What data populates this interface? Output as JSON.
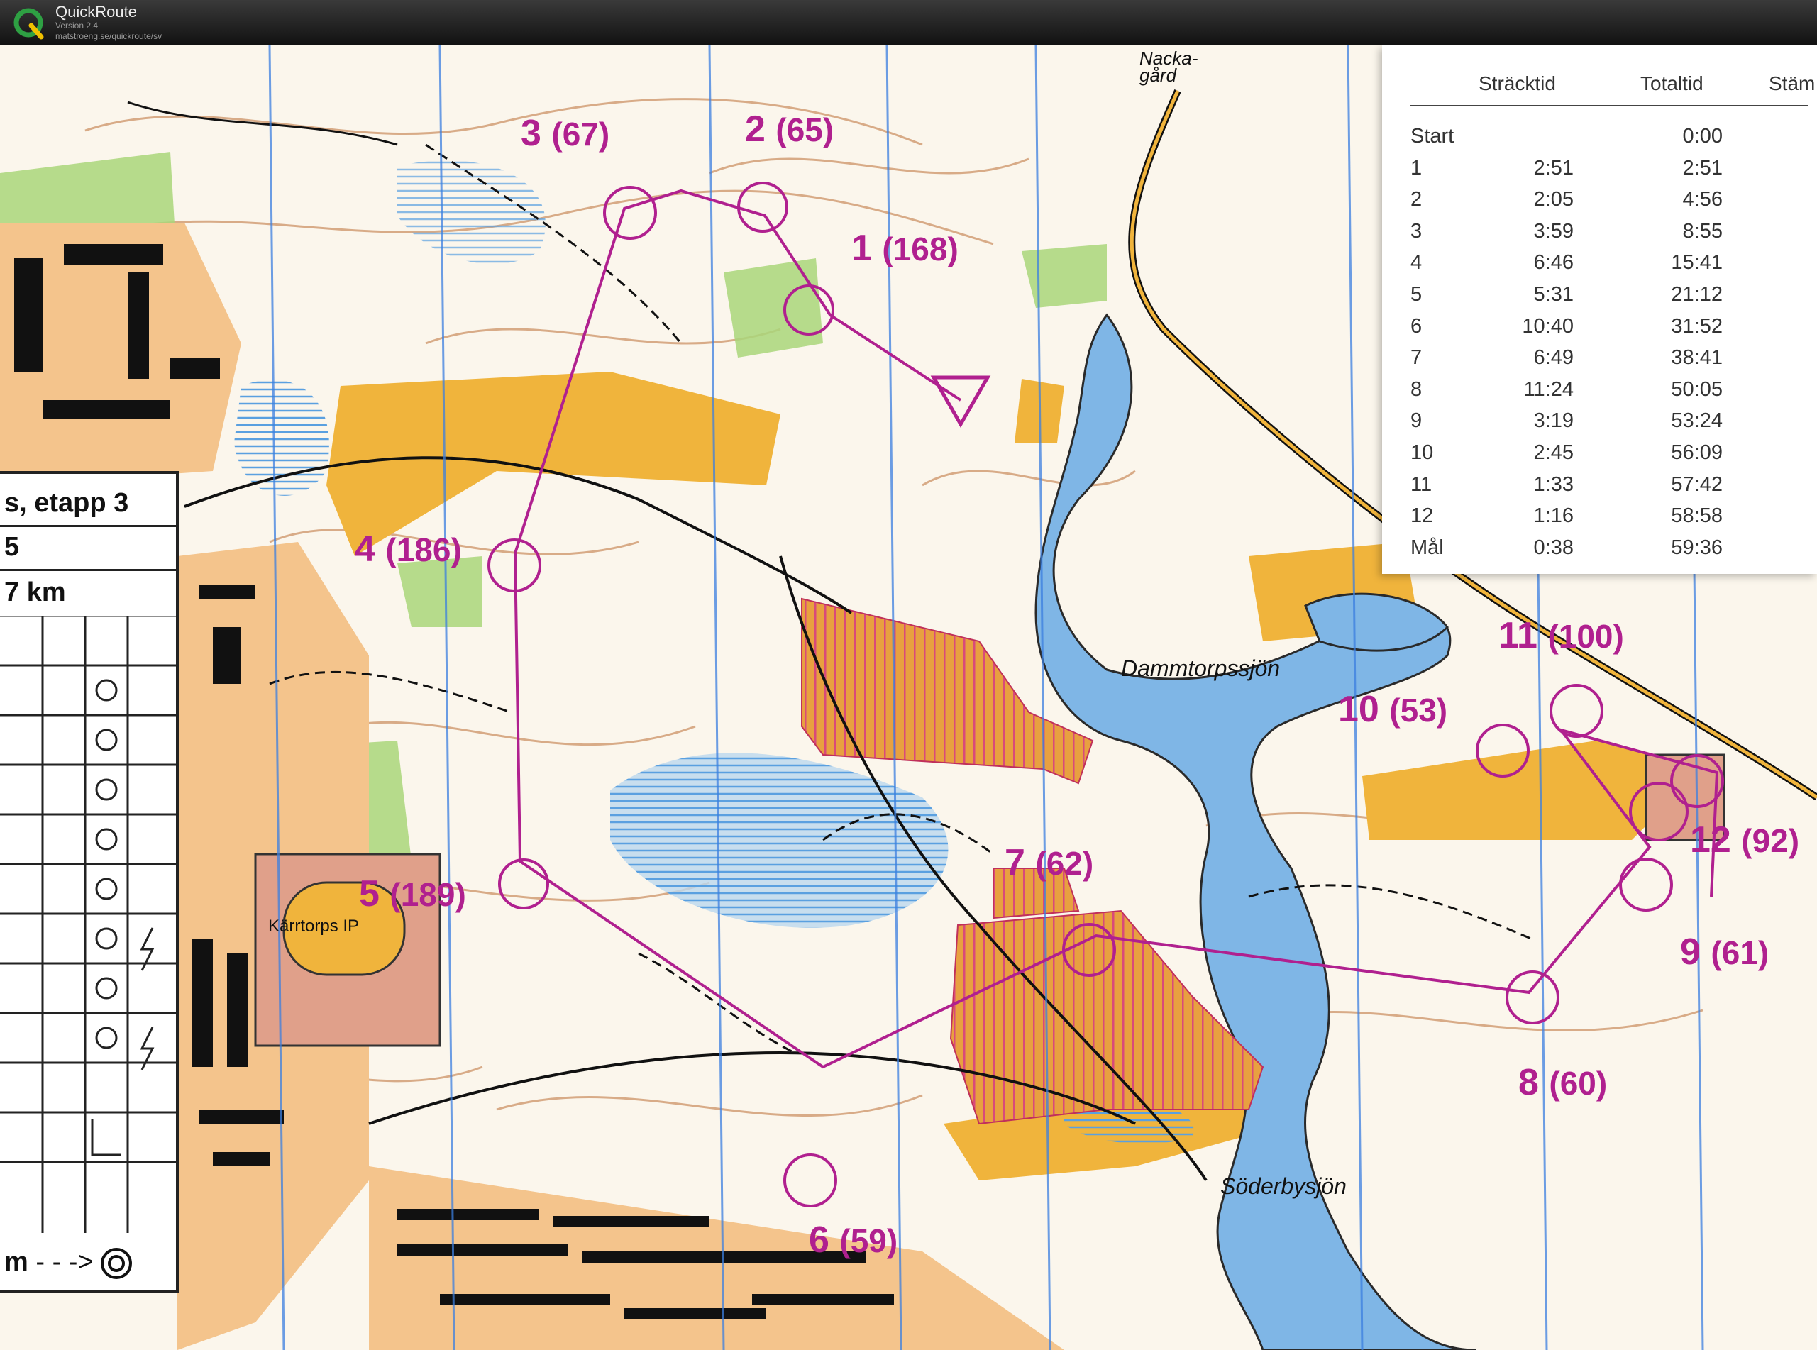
{
  "app": {
    "name": "QuickRoute",
    "version": "Version 2.4",
    "url": "matstroeng.se/quickroute/sv"
  },
  "map": {
    "place_labels": [
      {
        "id": "nacka",
        "text": "Nacka-\ngård"
      },
      {
        "id": "dammtorpssjon",
        "text": "Dammtorpssjön"
      },
      {
        "id": "soderbysjon",
        "text": "Söderbysjön"
      },
      {
        "id": "karrtorps",
        "text": "Kärrtorps IP"
      }
    ],
    "controls": [
      {
        "num": "1",
        "code": "(168)"
      },
      {
        "num": "2",
        "code": "(65)"
      },
      {
        "num": "3",
        "code": "(67)"
      },
      {
        "num": "4",
        "code": "(186)"
      },
      {
        "num": "5",
        "code": "(189)"
      },
      {
        "num": "6",
        "code": "(59)"
      },
      {
        "num": "7",
        "code": "(62)"
      },
      {
        "num": "8",
        "code": "(60)"
      },
      {
        "num": "9",
        "code": "(61)"
      },
      {
        "num": "10",
        "code": "(53)"
      },
      {
        "num": "11",
        "code": "(100)"
      },
      {
        "num": "12",
        "code": "(92)"
      }
    ]
  },
  "splits": {
    "headers": [
      "Sträcktid",
      "Totaltid",
      "Stäm"
    ],
    "rows": [
      {
        "label": "Start",
        "leg": "",
        "total": "0:00"
      },
      {
        "label": "1",
        "leg": "2:51",
        "total": "2:51"
      },
      {
        "label": "2",
        "leg": "2:05",
        "total": "4:56"
      },
      {
        "label": "3",
        "leg": "3:59",
        "total": "8:55"
      },
      {
        "label": "4",
        "leg": "6:46",
        "total": "15:41"
      },
      {
        "label": "5",
        "leg": "5:31",
        "total": "21:12"
      },
      {
        "label": "6",
        "leg": "10:40",
        "total": "31:52"
      },
      {
        "label": "7",
        "leg": "6:49",
        "total": "38:41"
      },
      {
        "label": "8",
        "leg": "11:24",
        "total": "50:05"
      },
      {
        "label": "9",
        "leg": "3:19",
        "total": "53:24"
      },
      {
        "label": "10",
        "leg": "2:45",
        "total": "56:09"
      },
      {
        "label": "11",
        "leg": "1:33",
        "total": "57:42"
      },
      {
        "label": "12",
        "leg": "1:16",
        "total": "58:58"
      },
      {
        "label": "Mål",
        "leg": "0:38",
        "total": "59:36"
      }
    ]
  },
  "description_card": {
    "title": "s, etapp 3",
    "line2": "5",
    "distance": "7 km",
    "finish": "m"
  },
  "colors": {
    "course": "#b0208f",
    "water": "#7fb6e6",
    "contour": "#b4632b",
    "yellow": "#f0b43c",
    "forbidden": "#e07070"
  }
}
